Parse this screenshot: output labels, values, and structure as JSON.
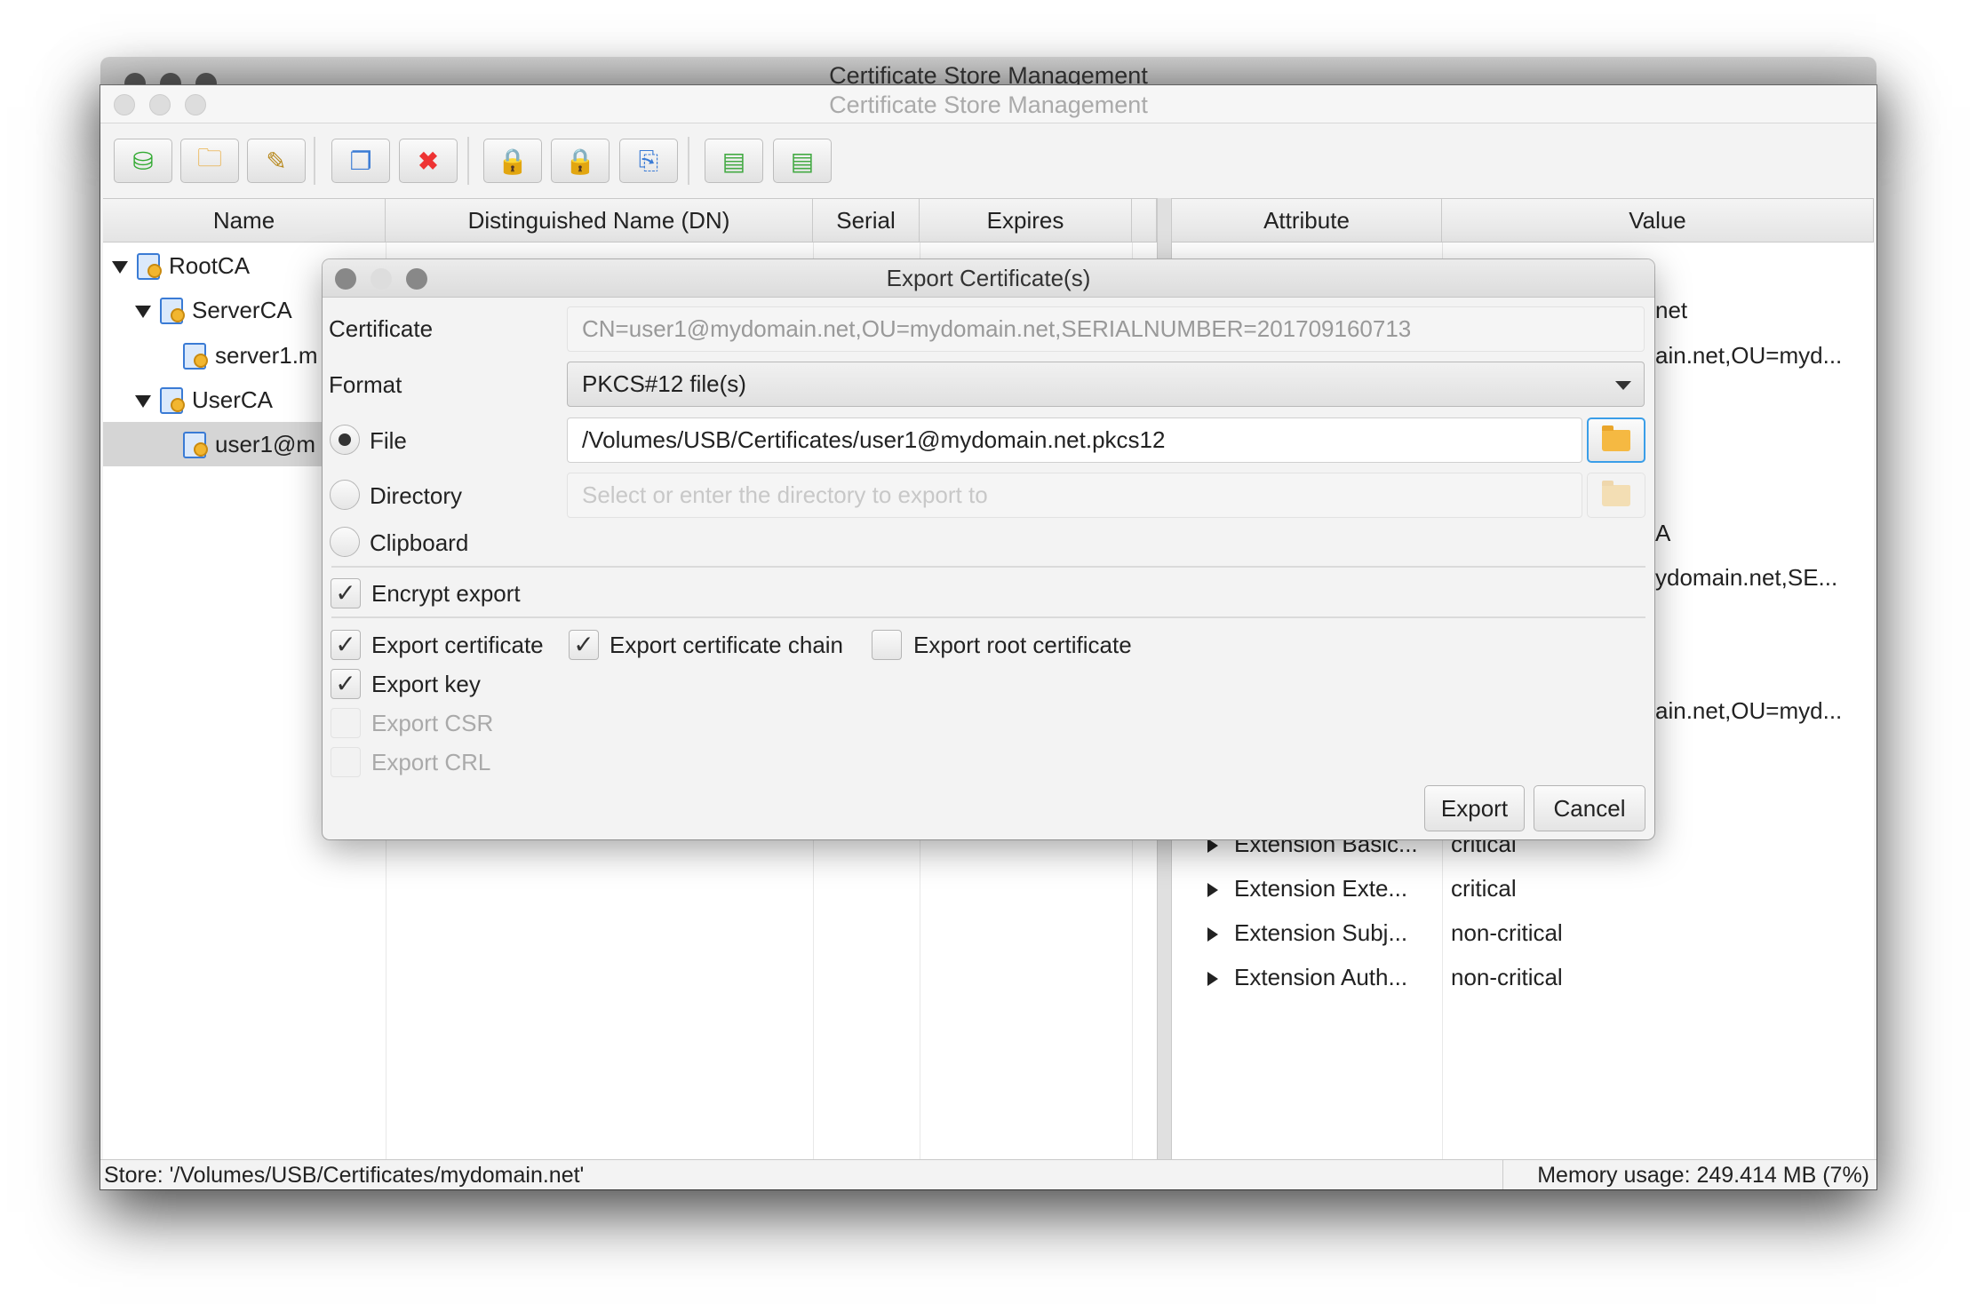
{
  "app": {
    "title": "Certificate Store Management"
  },
  "toolbar": {
    "buttons": [
      {
        "icon": "new-store-icon"
      },
      {
        "icon": "open-store-icon"
      },
      {
        "icon": "edit-store-icon"
      },
      {
        "icon": "copy-icon"
      },
      {
        "icon": "delete-icon"
      },
      {
        "icon": "add-key-icon"
      },
      {
        "icon": "remove-key-icon"
      },
      {
        "icon": "revoke-cert-icon"
      },
      {
        "icon": "import-icon"
      },
      {
        "icon": "export-icon"
      }
    ]
  },
  "table": {
    "columns": [
      "Name",
      "Distinguished Name (DN)",
      "Serial",
      "Expires"
    ],
    "rows": [
      {
        "name": "RootCA",
        "level": 0,
        "expanded": true
      },
      {
        "name": "ServerCA",
        "level": 1,
        "expanded": true
      },
      {
        "name": "server1.m",
        "level": 2
      },
      {
        "name": "UserCA",
        "level": 1,
        "expanded": true
      },
      {
        "name": "user1@m",
        "level": 2,
        "selected": true
      }
    ]
  },
  "details": {
    "columns": [
      "Attribute",
      "Value"
    ],
    "partial_values": [
      "net",
      "ain.net,OU=myd...",
      "A",
      "ydomain.net,SE...",
      "ain.net,OU=myd..."
    ],
    "rows": [
      {
        "attribute": "Extension Basic...",
        "value": "critical"
      },
      {
        "attribute": "Extension Exte...",
        "value": "critical"
      },
      {
        "attribute": "Extension Subj...",
        "value": "non-critical"
      },
      {
        "attribute": "Extension Auth...",
        "value": "non-critical"
      }
    ]
  },
  "status": {
    "store": "Store: '/Volumes/USB/Certificates/mydomain.net'",
    "memory": "Memory usage: 249.414 MB (7%)"
  },
  "dialog": {
    "title": "Export Certificate(s)",
    "certificate_label": "Certificate",
    "certificate_value": "CN=user1@mydomain.net,OU=mydomain.net,SERIALNUMBER=201709160713",
    "format_label": "Format",
    "format_value": "PKCS#12 file(s)",
    "file_label": "File",
    "file_value": "/Volumes/USB/Certificates/user1@mydomain.net.pkcs12",
    "directory_label": "Directory",
    "directory_placeholder": "Select or enter the directory to export to",
    "clipboard_label": "Clipboard",
    "selected_target": "File",
    "encrypt_label": "Encrypt export",
    "encrypt": true,
    "export_certificate_label": "Export certificate",
    "export_certificate": true,
    "export_chain_label": "Export certificate chain",
    "export_chain": true,
    "export_root_label": "Export root certificate",
    "export_root": false,
    "export_key_label": "Export key",
    "export_key": true,
    "export_csr_label": "Export CSR",
    "export_csr": false,
    "export_crl_label": "Export CRL",
    "export_crl": false,
    "export_button": "Export",
    "cancel_button": "Cancel"
  }
}
